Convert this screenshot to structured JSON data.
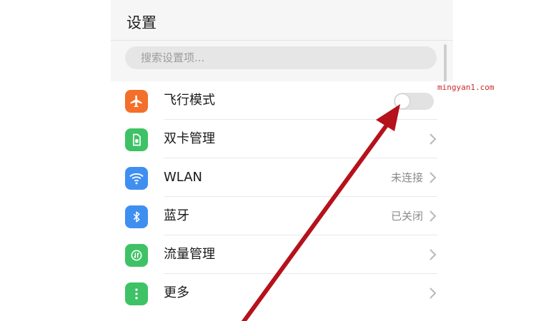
{
  "header": {
    "title": "设置"
  },
  "search": {
    "placeholder": "搜索设置项..."
  },
  "items": [
    {
      "label": "飞行模式",
      "icon": "airplane-icon",
      "icon_color": "#f36f2a",
      "control": "toggle",
      "toggle_on": false
    },
    {
      "label": "双卡管理",
      "icon": "sim-card-icon",
      "icon_color": "#3ec266",
      "control": "chevron"
    },
    {
      "label": "WLAN",
      "icon": "wifi-icon",
      "icon_color": "#3f8ff0",
      "value": "未连接",
      "control": "chevron"
    },
    {
      "label": "蓝牙",
      "icon": "bluetooth-icon",
      "icon_color": "#3f8ff0",
      "value": "已关闭",
      "control": "chevron"
    },
    {
      "label": "流量管理",
      "icon": "data-usage-icon",
      "icon_color": "#3ec266",
      "control": "chevron"
    },
    {
      "label": "更多",
      "icon": "more-icon",
      "icon_color": "#3ec266",
      "control": "chevron"
    }
  ],
  "watermark": "mingyan1.com",
  "colors": {
    "annotation_arrow": "#b5121b",
    "page_bg": "#f6f6f6"
  }
}
